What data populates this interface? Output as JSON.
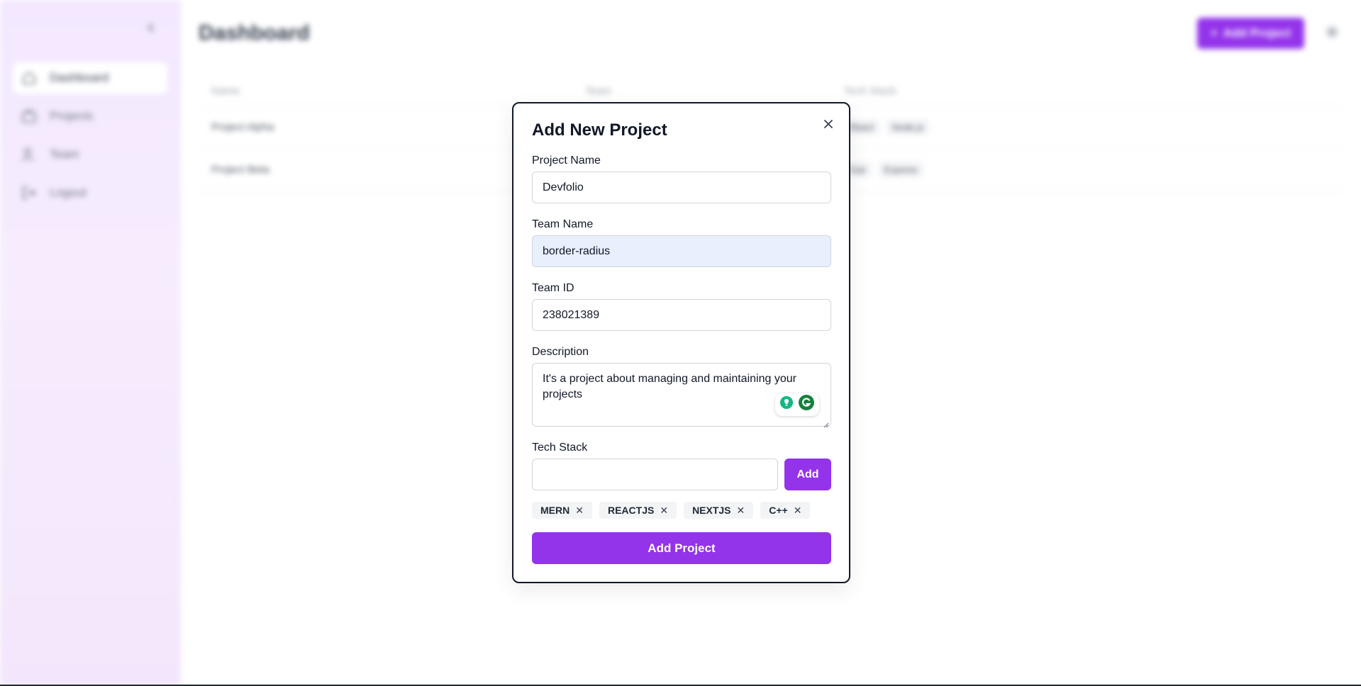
{
  "colors": {
    "accent": "#9333ea",
    "sidebar_bg": "#f3e8ff",
    "autofill_bg": "#e8f0fe",
    "chip_bg": "#f3f4f6"
  },
  "sidebar": {
    "collapse_icon": "chevron-left-icon",
    "items": [
      {
        "label": "Dashboard",
        "icon": "home-icon",
        "active": true
      },
      {
        "label": "Projects",
        "icon": "briefcase-icon",
        "active": false
      },
      {
        "label": "Team",
        "icon": "users-icon",
        "active": false
      },
      {
        "label": "Logout",
        "icon": "logout-icon",
        "active": false
      }
    ]
  },
  "header": {
    "title": "Dashboard",
    "add_button_label": "Add Project",
    "settings_icon": "gear-icon"
  },
  "table": {
    "columns": [
      "Name",
      "Team",
      "Tech Stack"
    ],
    "rows": [
      {
        "name": "Project Alpha",
        "team": "",
        "tech": [
          "React",
          "Node.js"
        ]
      },
      {
        "name": "Project Beta",
        "team": "",
        "tech": [
          "Vue",
          "Express"
        ]
      }
    ]
  },
  "modal": {
    "title": "Add New Project",
    "close_icon": "close-icon",
    "project_name": {
      "label": "Project Name",
      "value": "Devfolio"
    },
    "team_name": {
      "label": "Team Name",
      "value": "border-radius"
    },
    "team_id": {
      "label": "Team ID",
      "value": "238021389"
    },
    "description": {
      "label": "Description",
      "value": "It's a project about managing and maintaining your projects"
    },
    "tech_stack": {
      "label": "Tech Stack",
      "value": "",
      "add_label": "Add",
      "chips": [
        "MERN",
        "REACTJS",
        "NEXTJS",
        "C++"
      ]
    },
    "submit_label": "Add Project"
  }
}
